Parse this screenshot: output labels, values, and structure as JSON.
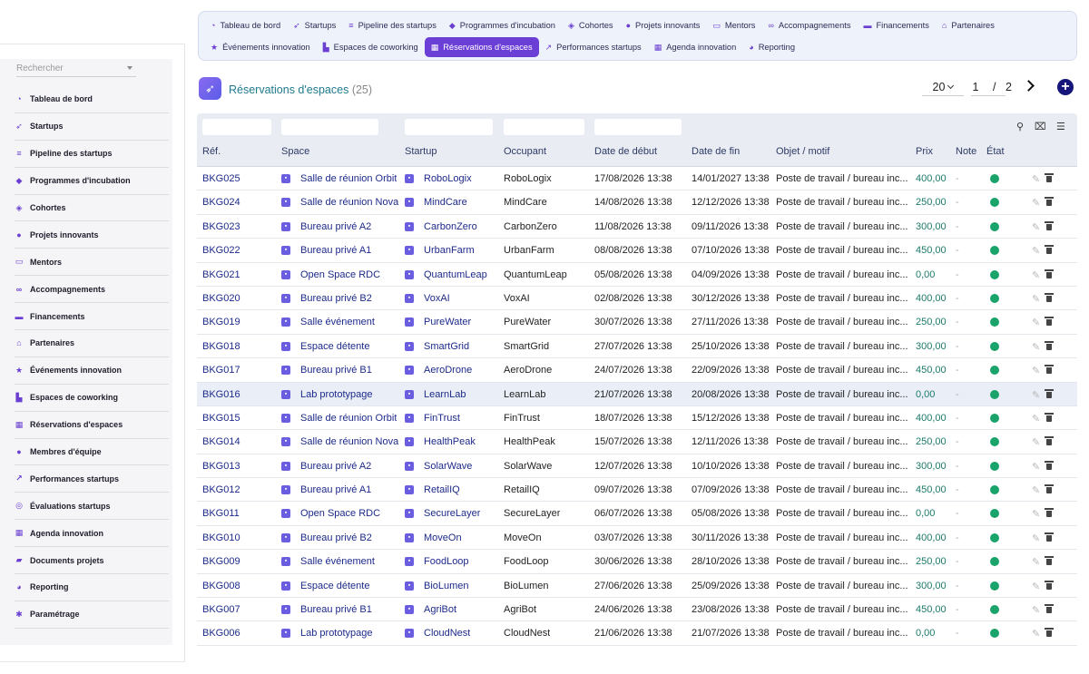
{
  "sidebar": {
    "search_placeholder": "Rechercher",
    "items": [
      {
        "label": "Tableau de bord",
        "icon": "gauge-icon",
        "glyph": "◔"
      },
      {
        "label": "Startups",
        "icon": "rocket-icon",
        "glyph": "➶"
      },
      {
        "label": "Pipeline des startups",
        "icon": "bars-icon",
        "glyph": "≡"
      },
      {
        "label": "Programmes d'incubation",
        "icon": "graduation-cap-icon",
        "glyph": "◆"
      },
      {
        "label": "Cohortes",
        "icon": "layers-icon",
        "glyph": "◈"
      },
      {
        "label": "Projets innovants",
        "icon": "lightbulb-icon",
        "glyph": "●"
      },
      {
        "label": "Mentors",
        "icon": "chalkboard-icon",
        "glyph": "▭"
      },
      {
        "label": "Accompagnements",
        "icon": "handshake-icon",
        "glyph": "∞"
      },
      {
        "label": "Financements",
        "icon": "money-icon",
        "glyph": "▬"
      },
      {
        "label": "Partenaires",
        "icon": "bank-icon",
        "glyph": "⌂"
      },
      {
        "label": "Événements innovation",
        "icon": "star-icon",
        "glyph": "★"
      },
      {
        "label": "Espaces de coworking",
        "icon": "building-icon",
        "glyph": "▙"
      },
      {
        "label": "Réservations d'espaces",
        "icon": "calendar-check-icon",
        "glyph": "▦"
      },
      {
        "label": "Membres d'équipe",
        "icon": "users-icon",
        "glyph": "●"
      },
      {
        "label": "Performances startups",
        "icon": "chart-line-icon",
        "glyph": "↗"
      },
      {
        "label": "Évaluations startups",
        "icon": "award-icon",
        "glyph": "◎"
      },
      {
        "label": "Agenda innovation",
        "icon": "calendar-icon",
        "glyph": "▦"
      },
      {
        "label": "Documents projets",
        "icon": "folder-icon",
        "glyph": "▰"
      },
      {
        "label": "Reporting",
        "icon": "pie-chart-icon",
        "glyph": "◕"
      },
      {
        "label": "Paramétrage",
        "icon": "gear-icon",
        "glyph": "✱"
      }
    ]
  },
  "topnav": {
    "row1": [
      {
        "label": "Tableau de bord",
        "icon": "gauge-icon",
        "glyph": "◔"
      },
      {
        "label": "Startups",
        "icon": "rocket-icon",
        "glyph": "➶"
      },
      {
        "label": "Pipeline des startups",
        "icon": "bars-icon",
        "glyph": "≡"
      },
      {
        "label": "Programmes d'incubation",
        "icon": "graduation-cap-icon",
        "glyph": "◆"
      },
      {
        "label": "Cohortes",
        "icon": "layers-icon",
        "glyph": "◈"
      },
      {
        "label": "Projets innovants",
        "icon": "lightbulb-icon",
        "glyph": "●"
      },
      {
        "label": "Mentors",
        "icon": "chalkboard-icon",
        "glyph": "▭"
      },
      {
        "label": "Accompagnements",
        "icon": "handshake-icon",
        "glyph": "∞"
      },
      {
        "label": "Financements",
        "icon": "money-icon",
        "glyph": "▬"
      },
      {
        "label": "Partenaires",
        "icon": "bank-icon",
        "glyph": "⌂"
      }
    ],
    "row2": [
      {
        "label": "Événements innovation",
        "icon": "star-icon",
        "glyph": "★"
      },
      {
        "label": "Espaces de coworking",
        "icon": "building-icon",
        "glyph": "▙"
      },
      {
        "label": "Réservations d'espaces",
        "icon": "calendar-check-icon",
        "glyph": "▦",
        "active": true
      },
      {
        "label": "Performances startups",
        "icon": "chart-line-icon",
        "glyph": "↗"
      },
      {
        "label": "Agenda innovation",
        "icon": "calendar-icon",
        "glyph": "▦"
      },
      {
        "label": "Reporting",
        "icon": "pie-chart-icon",
        "glyph": "◕"
      }
    ]
  },
  "header": {
    "title": "Réservations d'espaces",
    "count": "(25)",
    "logo_icon": "rocket-icon",
    "per_page": "20",
    "current_page": "1",
    "page_separator": "/",
    "total_pages": "2"
  },
  "table": {
    "columns": [
      "Réf.",
      "Space",
      "Startup",
      "Occupant",
      "Date de début",
      "Date de fin",
      "Objet / motif",
      "Prix",
      "Note",
      "État"
    ],
    "rows": [
      {
        "ref": "BKG025",
        "space": "Salle de réunion Orbit",
        "startup": "RoboLogix",
        "occupant": "RoboLogix",
        "start": "17/08/2026 13:38",
        "end": "14/01/2027 13:38",
        "purpose": "Poste de travail / bureau inc...",
        "price": "400,00",
        "note": "-"
      },
      {
        "ref": "BKG024",
        "space": "Salle de réunion Nova",
        "startup": "MindCare",
        "occupant": "MindCare",
        "start": "14/08/2026 13:38",
        "end": "12/12/2026 13:38",
        "purpose": "Poste de travail / bureau inc...",
        "price": "250,00",
        "note": "-"
      },
      {
        "ref": "BKG023",
        "space": "Bureau privé A2",
        "startup": "CarbonZero",
        "occupant": "CarbonZero",
        "start": "11/08/2026 13:38",
        "end": "09/11/2026 13:38",
        "purpose": "Poste de travail / bureau inc...",
        "price": "300,00",
        "note": "-"
      },
      {
        "ref": "BKG022",
        "space": "Bureau privé A1",
        "startup": "UrbanFarm",
        "occupant": "UrbanFarm",
        "start": "08/08/2026 13:38",
        "end": "07/10/2026 13:38",
        "purpose": "Poste de travail / bureau inc...",
        "price": "450,00",
        "note": "-"
      },
      {
        "ref": "BKG021",
        "space": "Open Space RDC",
        "startup": "QuantumLeap",
        "occupant": "QuantumLeap",
        "start": "05/08/2026 13:38",
        "end": "04/09/2026 13:38",
        "purpose": "Poste de travail / bureau inc...",
        "price": "0,00",
        "note": "-"
      },
      {
        "ref": "BKG020",
        "space": "Bureau privé B2",
        "startup": "VoxAI",
        "occupant": "VoxAI",
        "start": "02/08/2026 13:38",
        "end": "30/12/2026 13:38",
        "purpose": "Poste de travail / bureau inc...",
        "price": "400,00",
        "note": "-"
      },
      {
        "ref": "BKG019",
        "space": "Salle événement",
        "startup": "PureWater",
        "occupant": "PureWater",
        "start": "30/07/2026 13:38",
        "end": "27/11/2026 13:38",
        "purpose": "Poste de travail / bureau inc...",
        "price": "250,00",
        "note": "-"
      },
      {
        "ref": "BKG018",
        "space": "Espace détente",
        "startup": "SmartGrid",
        "occupant": "SmartGrid",
        "start": "27/07/2026 13:38",
        "end": "25/10/2026 13:38",
        "purpose": "Poste de travail / bureau inc...",
        "price": "300,00",
        "note": "-"
      },
      {
        "ref": "BKG017",
        "space": "Bureau privé B1",
        "startup": "AeroDrone",
        "occupant": "AeroDrone",
        "start": "24/07/2026 13:38",
        "end": "22/09/2026 13:38",
        "purpose": "Poste de travail / bureau inc...",
        "price": "450,00",
        "note": "-"
      },
      {
        "ref": "BKG016",
        "space": "Lab prototypage",
        "startup": "LearnLab",
        "occupant": "LearnLab",
        "start": "21/07/2026 13:38",
        "end": "20/08/2026 13:38",
        "purpose": "Poste de travail / bureau inc...",
        "price": "0,00",
        "note": "-"
      },
      {
        "ref": "BKG015",
        "space": "Salle de réunion Orbit",
        "startup": "FinTrust",
        "occupant": "FinTrust",
        "start": "18/07/2026 13:38",
        "end": "15/12/2026 13:38",
        "purpose": "Poste de travail / bureau inc...",
        "price": "400,00",
        "note": "-"
      },
      {
        "ref": "BKG014",
        "space": "Salle de réunion Nova",
        "startup": "HealthPeak",
        "occupant": "HealthPeak",
        "start": "15/07/2026 13:38",
        "end": "12/11/2026 13:38",
        "purpose": "Poste de travail / bureau inc...",
        "price": "250,00",
        "note": "-"
      },
      {
        "ref": "BKG013",
        "space": "Bureau privé A2",
        "startup": "SolarWave",
        "occupant": "SolarWave",
        "start": "12/07/2026 13:38",
        "end": "10/10/2026 13:38",
        "purpose": "Poste de travail / bureau inc...",
        "price": "300,00",
        "note": "-"
      },
      {
        "ref": "BKG012",
        "space": "Bureau privé A1",
        "startup": "RetailIQ",
        "occupant": "RetailIQ",
        "start": "09/07/2026 13:38",
        "end": "07/09/2026 13:38",
        "purpose": "Poste de travail / bureau inc...",
        "price": "450,00",
        "note": "-"
      },
      {
        "ref": "BKG011",
        "space": "Open Space RDC",
        "startup": "SecureLayer",
        "occupant": "SecureLayer",
        "start": "06/07/2026 13:38",
        "end": "05/08/2026 13:38",
        "purpose": "Poste de travail / bureau inc...",
        "price": "0,00",
        "note": "-"
      },
      {
        "ref": "BKG010",
        "space": "Bureau privé B2",
        "startup": "MoveOn",
        "occupant": "MoveOn",
        "start": "03/07/2026 13:38",
        "end": "30/11/2026 13:38",
        "purpose": "Poste de travail / bureau inc...",
        "price": "400,00",
        "note": "-"
      },
      {
        "ref": "BKG009",
        "space": "Salle événement",
        "startup": "FoodLoop",
        "occupant": "FoodLoop",
        "start": "30/06/2026 13:38",
        "end": "28/10/2026 13:38",
        "purpose": "Poste de travail / bureau inc...",
        "price": "250,00",
        "note": "-"
      },
      {
        "ref": "BKG008",
        "space": "Espace détente",
        "startup": "BioLumen",
        "occupant": "BioLumen",
        "start": "27/06/2026 13:38",
        "end": "25/09/2026 13:38",
        "purpose": "Poste de travail / bureau inc...",
        "price": "300,00",
        "note": "-"
      },
      {
        "ref": "BKG007",
        "space": "Bureau privé B1",
        "startup": "AgriBot",
        "occupant": "AgriBot",
        "start": "24/06/2026 13:38",
        "end": "23/08/2026 13:38",
        "purpose": "Poste de travail / bureau inc...",
        "price": "450,00",
        "note": "-"
      },
      {
        "ref": "BKG006",
        "space": "Lab prototypage",
        "startup": "CloudNest",
        "occupant": "CloudNest",
        "start": "21/06/2026 13:38",
        "end": "21/07/2026 13:38",
        "purpose": "Poste de travail / bureau inc...",
        "price": "0,00",
        "note": "-"
      }
    ],
    "highlighted_row": 9,
    "status_color": "#1aa36a",
    "accent": "#6b3ed6"
  }
}
